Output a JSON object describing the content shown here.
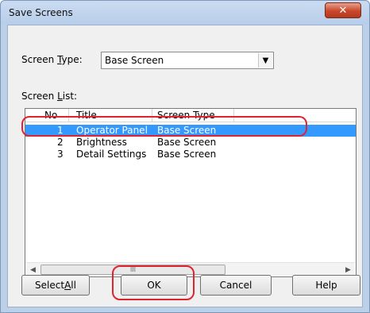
{
  "window": {
    "title": "Save Screens",
    "close_glyph": "✕"
  },
  "screen_type": {
    "label_pre": "Screen ",
    "label_key": "T",
    "label_post": "ype:",
    "value": "Base Screen"
  },
  "screen_list": {
    "label_pre": "Screen ",
    "label_key": "L",
    "label_post": "ist:",
    "columns": [
      "No",
      "Title",
      "Screen Type"
    ],
    "rows": [
      {
        "no": "1",
        "title": "Operator Panel",
        "type": "Base Screen",
        "selected": true
      },
      {
        "no": "2",
        "title": "Brightness",
        "type": "Base Screen",
        "selected": false
      },
      {
        "no": "3",
        "title": "Detail Settings",
        "type": "Base Screen",
        "selected": false
      }
    ],
    "scroll_left": "◀",
    "scroll_right": "▶",
    "scroll_grip": "III"
  },
  "buttons": {
    "select_all_pre": "Select ",
    "select_all_key": "A",
    "select_all_post": "ll",
    "ok": "OK",
    "cancel": "Cancel",
    "help": "Help"
  },
  "colors": {
    "highlight": "#e0242f",
    "selection": "#3399ff"
  }
}
